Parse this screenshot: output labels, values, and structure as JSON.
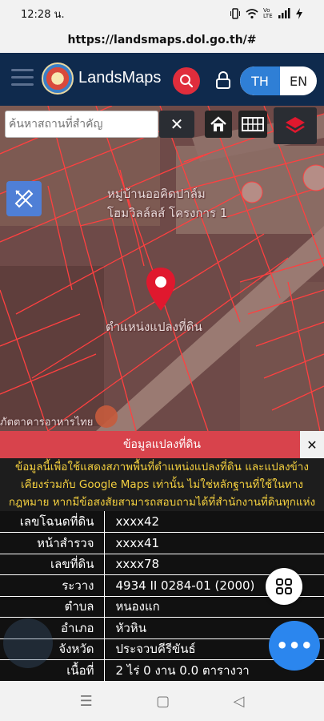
{
  "status_bar": {
    "time": "12:28 น.",
    "icons": [
      "vibrate-icon",
      "wifi-icon",
      "signal-icon",
      "charging-icon"
    ],
    "network_label": "Vo LTE"
  },
  "browser": {
    "url": "https://landsmaps.dol.go.th/#"
  },
  "header": {
    "brand": "LandsMaps",
    "lang_th": "TH",
    "lang_en": "EN",
    "active_lang": "TH",
    "colors": {
      "bar": "#0f2a4d",
      "search": "#e02d3c",
      "lang_active": "#2f7fd6"
    }
  },
  "map": {
    "search_placeholder": "ค้นหาสถานที่สำคัญ",
    "village_label_line1": "หมู่บ้านออคิดปาล์ม",
    "village_label_line2": "โฮมวิลล์ลส์ โครงการ 1",
    "pin_label": "ตำแหน่งแปลงที่ดิน",
    "poi_label": "ภัตตาคารอาหารไทย",
    "line_color": "#ff3b3b",
    "pin_color": "#e0182e"
  },
  "panel": {
    "title": "ข้อมูลแปลงที่ดิน",
    "notice": "ข้อมูลนี้เพื่อใช้แสดงสภาพพื้นที่ตำแหน่งแปลงที่ดิน และแปลงข้างเคียงร่วมกับ Google Maps เท่านั้น ไม่ใช่หลักฐานที่ใช้ในทางกฎหมาย หากมีข้อสงสัยสามารถสอบถามได้ที่สำนักงานที่ดินทุกแห่ง",
    "rows": [
      {
        "key": "เลขโฉนดที่ดิน",
        "value": "xxxx42"
      },
      {
        "key": "หน้าสำรวจ",
        "value": "xxxx41"
      },
      {
        "key": "เลขที่ดิน",
        "value": "xxxx78"
      },
      {
        "key": "ระวาง",
        "value": "4934 II 0284-01 (2000)"
      },
      {
        "key": "ตำบล",
        "value": "หนองแก"
      },
      {
        "key": "อำเภอ",
        "value": "หัวหิน"
      },
      {
        "key": "จังหวัด",
        "value": "ประจวบคีรีขันธ์"
      },
      {
        "key": "เนื้อที่",
        "value": "2 ไร่ 0 งาน 0.0 ตารางวา"
      }
    ]
  }
}
